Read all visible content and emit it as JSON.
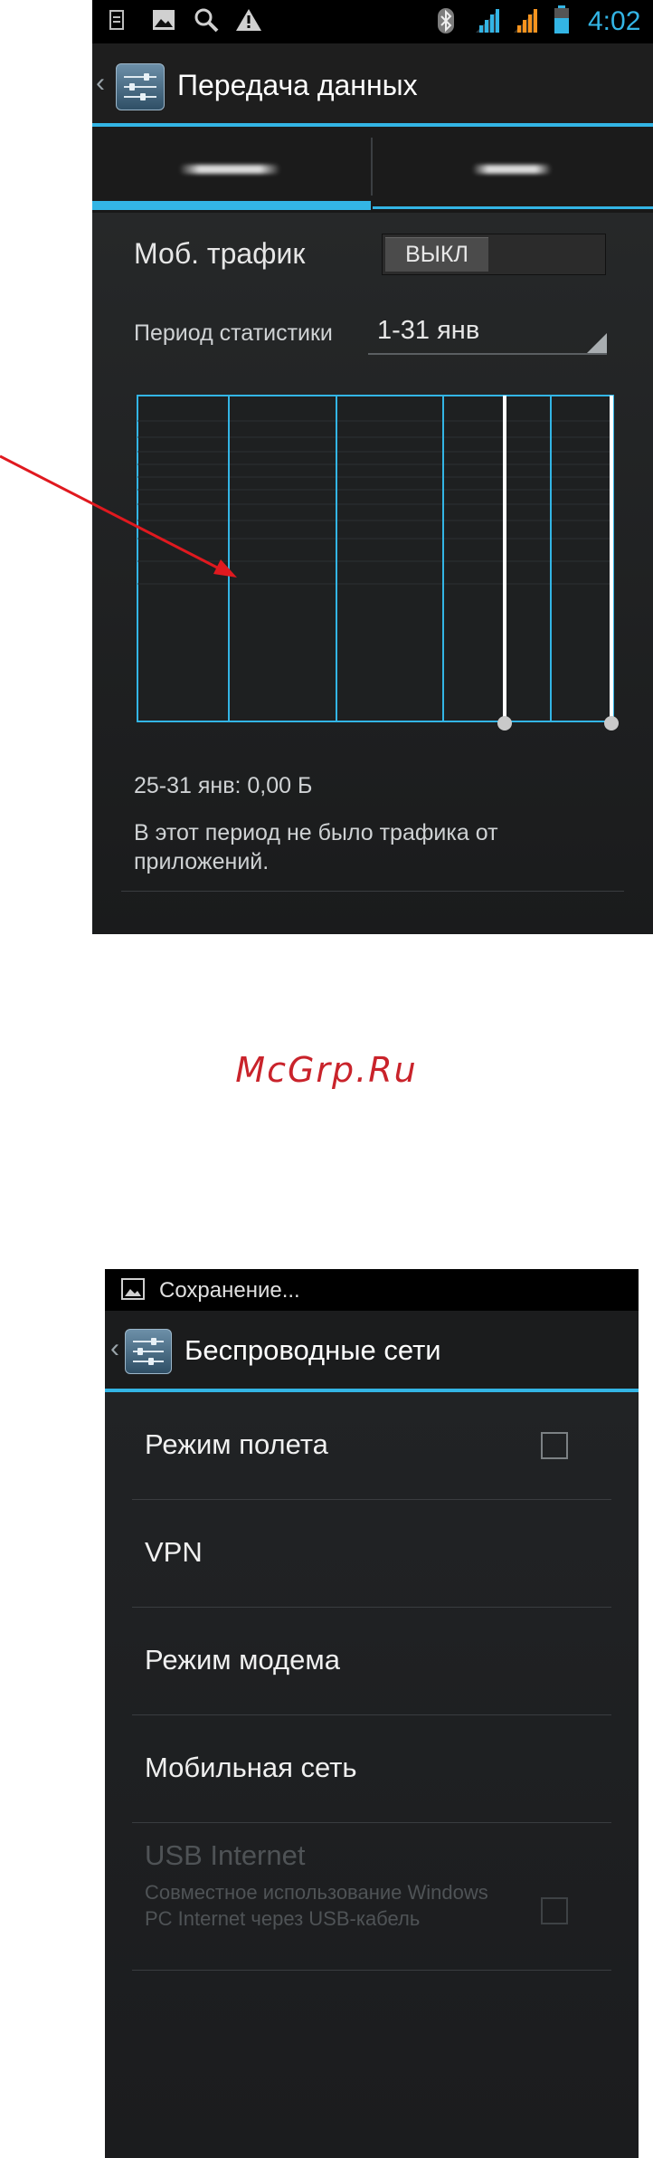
{
  "screen1": {
    "status_bar": {
      "time": "4:02",
      "icons": [
        "sim-card-icon",
        "image-icon",
        "search-icon",
        "warning-icon",
        "bluetooth-icon",
        "signal-icon",
        "signal-icon",
        "battery-icon"
      ]
    },
    "action_bar": {
      "title": "Передача данных"
    },
    "mobile_traffic": {
      "label": "Моб. трафик",
      "toggle": "ВЫКЛ"
    },
    "period": {
      "label": "Период статистики",
      "value": "1-31 янв"
    },
    "summary": "25-31 янв: 0,00 Б",
    "note": "В этот период не было трафика от приложений."
  },
  "watermark": "McGrp.Ru",
  "screen2": {
    "status_bar": {
      "notification": "Сохранение..."
    },
    "action_bar": {
      "title": "Беспроводные сети"
    },
    "items": [
      {
        "title": "Режим полета",
        "checkbox": true,
        "enabled": true
      },
      {
        "title": "VPN",
        "enabled": true
      },
      {
        "title": "Режим модема",
        "enabled": true
      },
      {
        "title": "Мобильная сеть",
        "enabled": true
      },
      {
        "title": "USB Internet",
        "summary": "Совместное использование Windows PC Internet через USB-кабель",
        "checkbox": true,
        "enabled": false
      }
    ]
  },
  "colors": {
    "accent": "#33b5e5",
    "annotation_arrow": "#e0191f",
    "watermark": "#c9232b"
  }
}
